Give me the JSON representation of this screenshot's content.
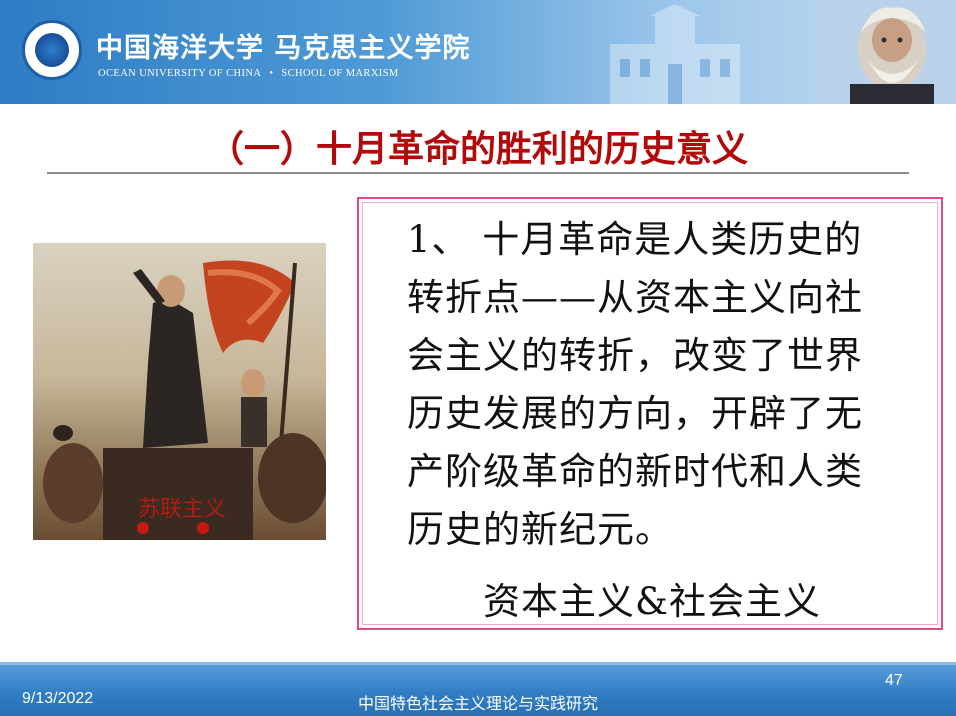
{
  "header": {
    "university_cn": "中国海洋大学 马克思主义学院",
    "university_en": "OCEAN UNIVERSITY OF CHINA",
    "school_en": "SCHOOL OF MARXISM",
    "separator": "•"
  },
  "slide": {
    "title": "（一）十月革命的胜利的历史意义",
    "poster_caption": "苏联主义",
    "body_lines": [
      "1、 十月革命是人类历史的",
      "转折点——从资本主义向社",
      "会主义的转折，改变了世界",
      "历史发展的方向，开辟了无",
      "产阶级革命的新时代和人类",
      "历史的新纪元。"
    ],
    "subline": "资本主义&社会主义"
  },
  "footer": {
    "date": "9/13/2022",
    "course": "中国特色社会主义理论与实践研究",
    "page_number": "47"
  },
  "colors": {
    "title": "#b20a0a",
    "banner": "#2e7cc4",
    "box_border": "#e0498a",
    "footer": "#2f7cc3"
  }
}
